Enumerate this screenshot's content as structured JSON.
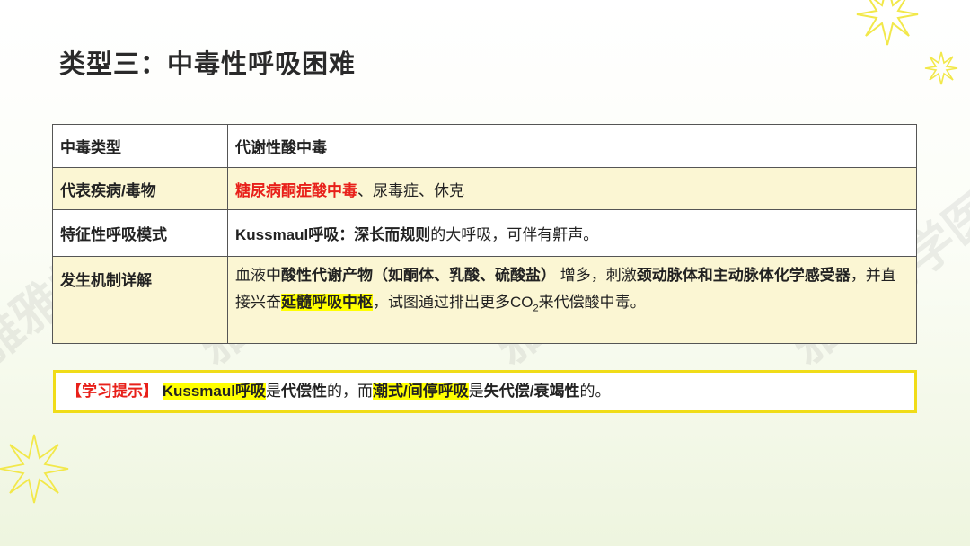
{
  "title": "类型三：中毒性呼吸困难",
  "table": {
    "rows": [
      {
        "label": "中毒类型",
        "value": "代谢性酸中毒"
      },
      {
        "label": "代表疾病/毒物",
        "value_red": "糖尿病酮症酸中毒",
        "value_rest": "、尿毒症、休克"
      },
      {
        "label": "特征性呼吸模式",
        "value_bold": "Kussmaul呼吸：深长而规则",
        "value_rest": "的大呼吸，可伴有鼾声。"
      },
      {
        "label": "发生机制详解",
        "p1": "血液中",
        "p2": "酸性代谢产物（如酮体、乳酸、硫酸盐）",
        "p3": " 增多，刺激",
        "p4": "颈动脉体和主动脉体化学感受器",
        "p5": "，并直接兴奋",
        "p6": "延髓呼吸中枢",
        "p7": "，试图通过排出更多CO",
        "p8": "2",
        "p9": "来代偿酸中毒。"
      }
    ]
  },
  "tip": {
    "label": "【学习提示】",
    "t1": "Kussmaul呼吸",
    "t2": "是",
    "t3": "代偿性",
    "t4": "的，而",
    "t5": "潮式/间停呼吸",
    "t6": "是",
    "t7": "失代偿/衰竭性",
    "t8": "的。"
  },
  "watermark": "雅雅的学医记",
  "colors": {
    "accent_red": "#e8201a",
    "highlight": "#ffff00",
    "tip_border": "#f0dc18",
    "row_tint": "#fbf6d3"
  },
  "icons": [
    "sunburst-icon"
  ]
}
